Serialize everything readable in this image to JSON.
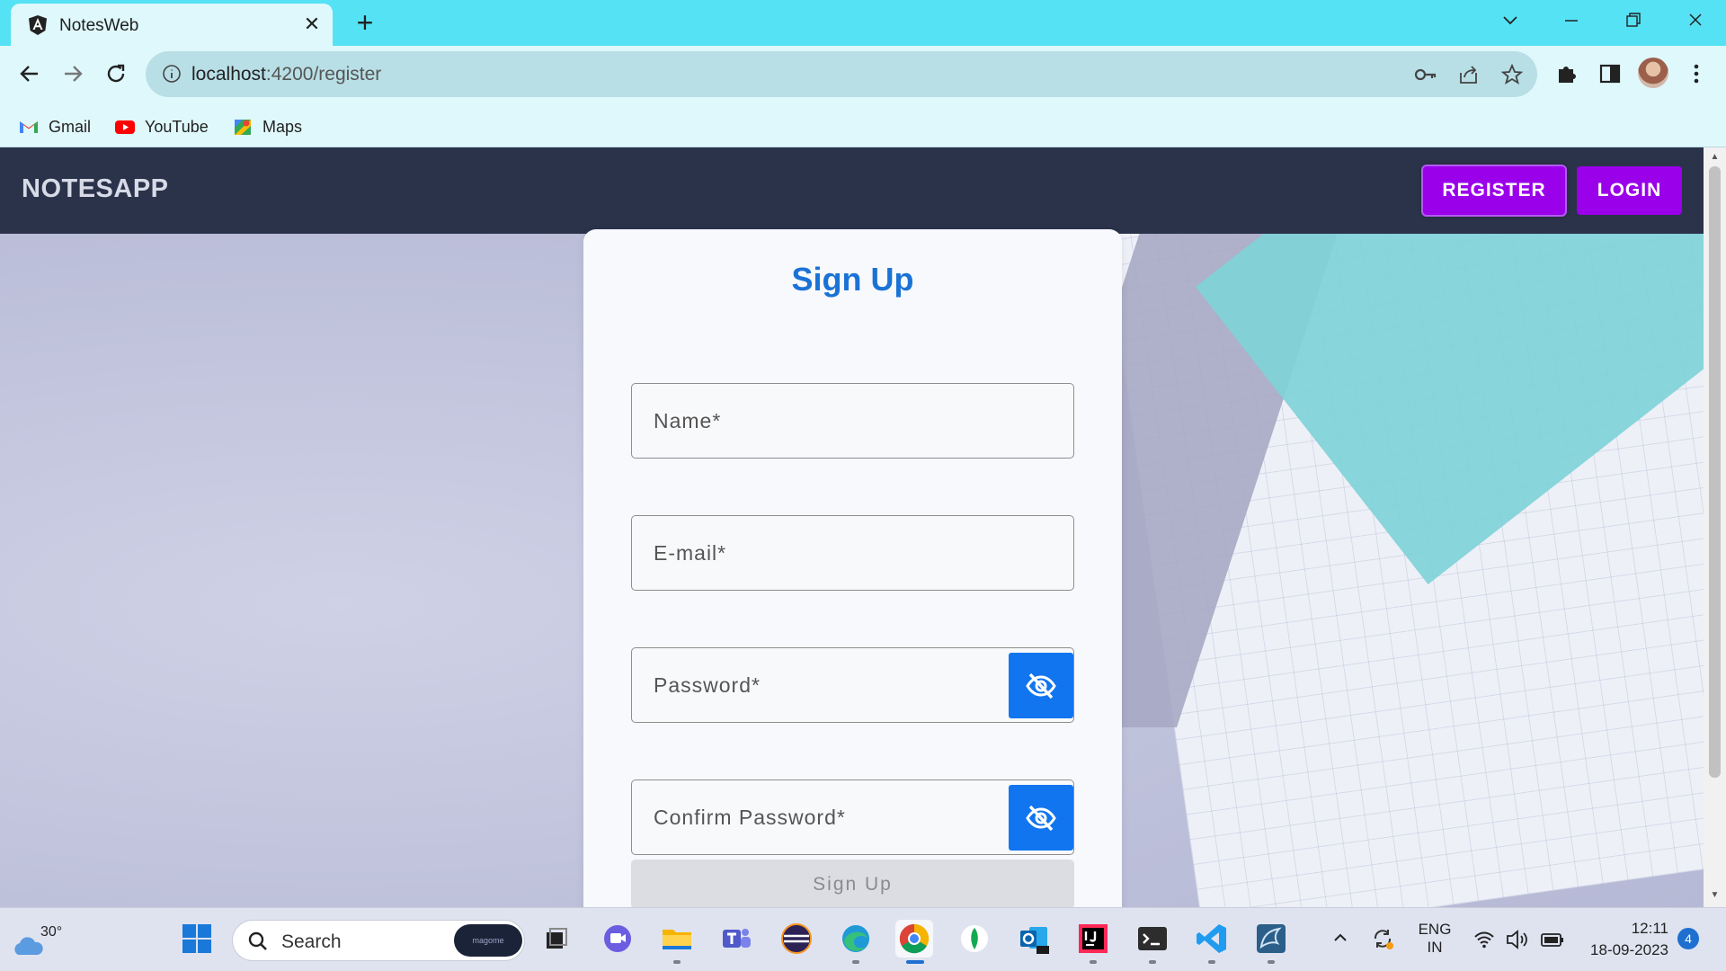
{
  "browser": {
    "tab_title": "NotesWeb",
    "url_host": "localhost",
    "url_path": ":4200/register",
    "bookmarks": [
      {
        "label": "Gmail",
        "icon": "gmail-icon"
      },
      {
        "label": "YouTube",
        "icon": "youtube-icon"
      },
      {
        "label": "Maps",
        "icon": "maps-icon"
      }
    ]
  },
  "app": {
    "brand": "NOTESAPP",
    "nav": {
      "register": "REGISTER",
      "login": "LOGIN"
    },
    "colors": {
      "navbar": "#2b334b",
      "nav_button": "#9a00ea",
      "title": "#1b72d6",
      "eye_button": "#1175f0"
    }
  },
  "form": {
    "title": "Sign Up",
    "name_placeholder": "Name*",
    "email_placeholder": "E-mail*",
    "password_placeholder": "Password*",
    "confirm_placeholder": "Confirm Password*",
    "submit_label": "Sign Up"
  },
  "taskbar": {
    "temperature": "30°",
    "search_label": "Search",
    "search_pill": "magome",
    "lang_line1": "ENG",
    "lang_line2": "IN",
    "time": "12:11",
    "date": "18-09-2023",
    "notification_count": "4"
  }
}
